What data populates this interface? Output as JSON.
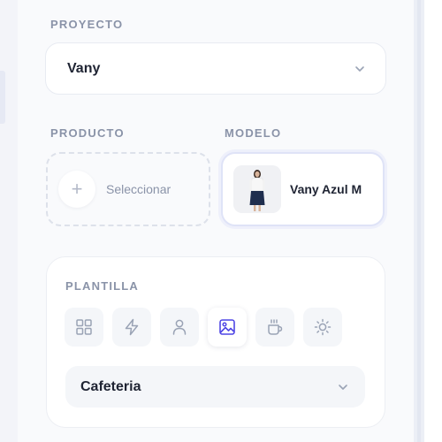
{
  "project": {
    "label": "PROYECTO",
    "value": "Vany",
    "chevron_icon": "chevron-down-icon"
  },
  "product": {
    "label": "PRODUCTO",
    "placeholder": "Seleccionar",
    "add_icon": "plus-icon",
    "add_glyph": "+"
  },
  "model": {
    "label": "MODELO",
    "name": "Vany Azul M"
  },
  "template": {
    "label": "PLANTILLA",
    "icons": [
      "grid-icon",
      "lightning-icon",
      "person-icon",
      "image-icon",
      "coffee-cup-icon",
      "sun-icon"
    ],
    "active_index": 3,
    "select_value": "Cafeteria"
  },
  "colors": {
    "accent": "#4f46e5",
    "icon_gray": "#9aa3b5",
    "text_dark": "#1f2433",
    "label_gray": "#8a93a8"
  }
}
